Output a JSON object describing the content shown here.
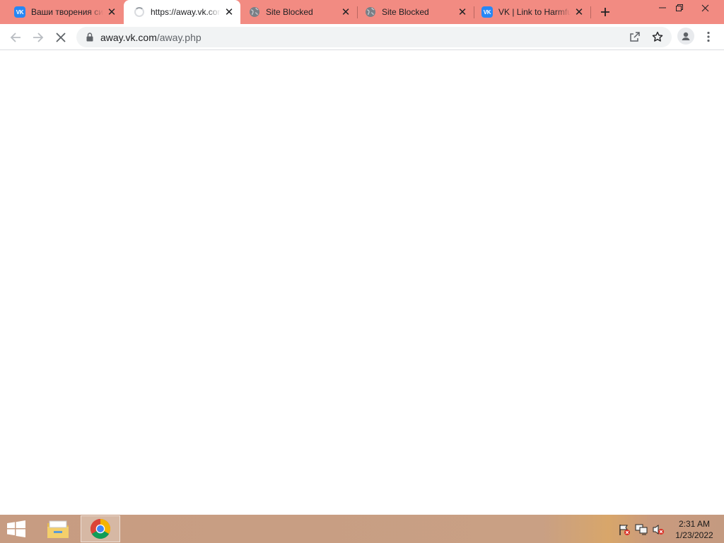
{
  "browser": {
    "tabs": [
      {
        "title": "Ваши творения си",
        "favicon": "vk-icon",
        "active": false
      },
      {
        "title": "https://away.vk.com",
        "favicon": "loading-spinner-icon",
        "active": true
      },
      {
        "title": "Site Blocked",
        "favicon": "globe-icon",
        "active": false
      },
      {
        "title": "Site Blocked",
        "favicon": "globe-icon",
        "active": false
      },
      {
        "title": "VK | Link to Harmful",
        "favicon": "vk-icon",
        "active": false
      }
    ],
    "vk_logo_text": "VK",
    "new_tab_icon": "plus-icon",
    "window_controls": [
      "minimize-icon",
      "restore-icon",
      "close-icon"
    ],
    "toolbar": {
      "back_icon": "arrow-left-icon",
      "forward_icon": "arrow-right-icon",
      "stop_icon": "close-icon",
      "url_host": "away.vk.com",
      "url_path": "/away.php",
      "share_icon": "share-icon",
      "bookmark_icon": "star-icon",
      "profile_icon": "person-icon",
      "menu_icon": "kebab-menu-icon"
    }
  },
  "taskbar": {
    "start_icon": "windows-logo-icon",
    "apps": [
      {
        "name": "file-explorer-icon",
        "active": false
      },
      {
        "name": "chrome-icon",
        "active": true
      }
    ],
    "tray_icons": [
      "action-center-flag-icon",
      "network-icon",
      "speaker-muted-icon"
    ],
    "time": "2:31 AM",
    "date": "1/23/2022"
  },
  "colors": {
    "tabstrip": "#f28b82",
    "accent_vk": "#2787f5",
    "omnibox": "#f1f3f4"
  }
}
